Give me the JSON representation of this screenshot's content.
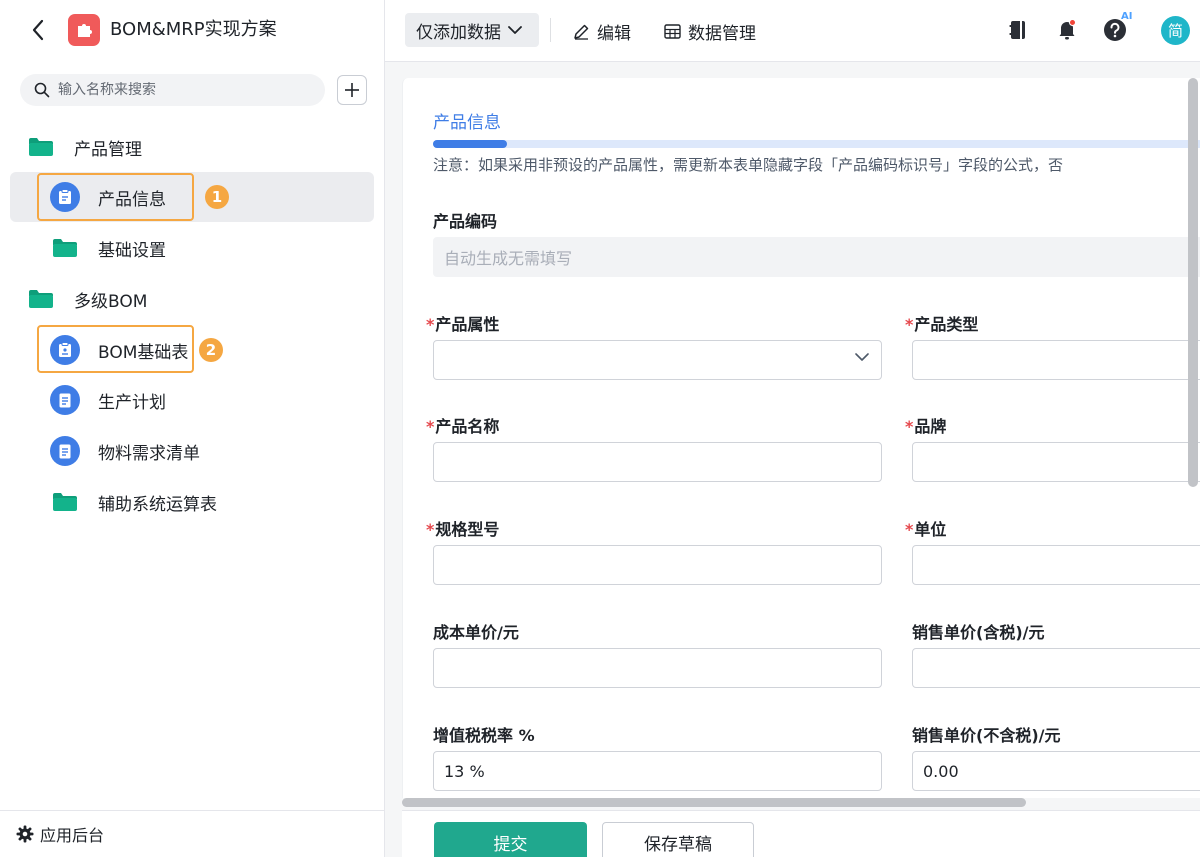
{
  "app": {
    "title": "BOM&MRP实现方案",
    "logo_color": "#f05a5a"
  },
  "sidebar": {
    "search_placeholder": "输入名称来搜索",
    "groups": [
      {
        "label": "产品管理",
        "icon": "folder-icon"
      },
      {
        "label": "多级BOM",
        "icon": "folder-icon"
      }
    ],
    "items": [
      {
        "label": "产品信息",
        "icon": "form-icon",
        "active": true,
        "badge": "1"
      },
      {
        "label": "基础设置",
        "icon": "folder-icon"
      },
      {
        "label": "BOM基础表",
        "icon": "form-icon",
        "badge": "2"
      },
      {
        "label": "生产计划",
        "icon": "document-icon"
      },
      {
        "label": "物料需求清单",
        "icon": "document-icon"
      },
      {
        "label": "辅助系统运算表",
        "icon": "folder-icon"
      }
    ],
    "footer_label": "应用后台",
    "accent_color": "#3f7de6",
    "folder_color": "#13b38b",
    "highlight_color": "#f5a742"
  },
  "toolbar": {
    "primary_label": "仅添加数据",
    "edit_label": "编辑",
    "data_manage_label": "数据管理",
    "ai_tag": "AI",
    "avatar_text": "简"
  },
  "form": {
    "section_title": "产品信息",
    "notice": "注意：如果采用非预设的产品属性，需更新本表单隐藏字段「产品编码标识号」字段的公式，否",
    "product_code_label": "产品编码",
    "product_code_placeholder": "自动生成无需填写",
    "fields": {
      "product_attr": "产品属性",
      "product_type": "产品类型",
      "product_name": "产品名称",
      "brand": "品牌",
      "spec_model": "规格型号",
      "unit": "单位",
      "cost_price": "成本单价/元",
      "sale_price_tax": "销售单价(含税)/元",
      "vat_rate": "增值税税率 %",
      "sale_price_notax": "销售单价(不含税)/元"
    },
    "values": {
      "vat_rate": "13 %",
      "sale_price_notax": "0.00"
    },
    "submit_label": "提交",
    "draft_label": "保存草稿",
    "submit_color": "#20a88e"
  }
}
